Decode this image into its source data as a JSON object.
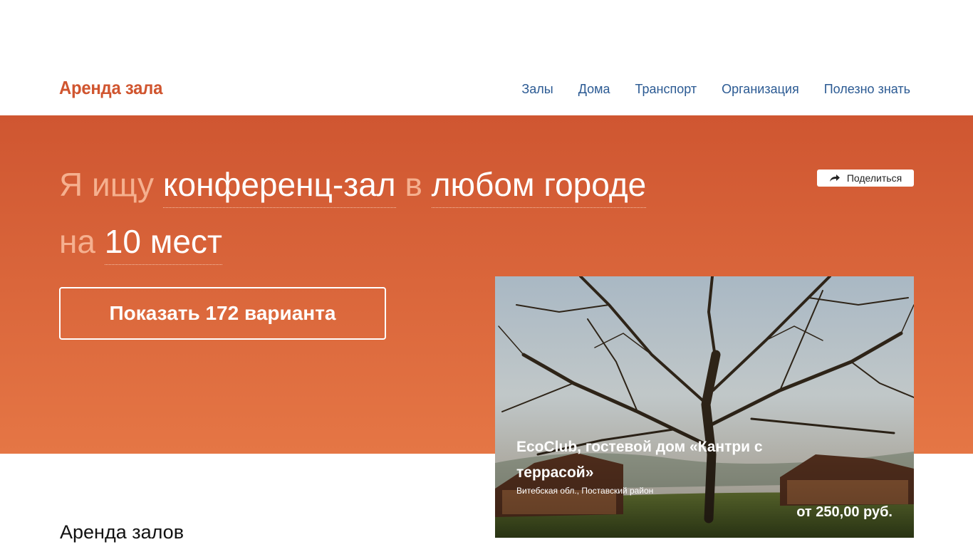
{
  "header": {
    "logo": "Аренда зала",
    "nav": [
      {
        "label": "Залы"
      },
      {
        "label": "Дома"
      },
      {
        "label": "Транспорт"
      },
      {
        "label": "Организация"
      },
      {
        "label": "Полезно знать"
      }
    ]
  },
  "search": {
    "prefix": "Я ищу",
    "venue_type": "конференц-зал",
    "in_word": "в",
    "city": "любом городе",
    "on_word": "на",
    "capacity": "10 мест",
    "show_button": "Показать 172 варианта"
  },
  "share": {
    "label": "Поделиться"
  },
  "featured": {
    "title": "EcoClub, гостевой дом «Кантри с террасой»",
    "region": "Витебская обл., Поставский район",
    "price": "от 250,00 руб."
  },
  "sections": {
    "hall_rent_title": "Аренда залов"
  },
  "colors": {
    "accent": "#d0552f",
    "hero_top": "#cf5631",
    "hero_bottom": "#e57645",
    "nav_link": "#2b5a93",
    "muted_text": "#f5b08f"
  }
}
